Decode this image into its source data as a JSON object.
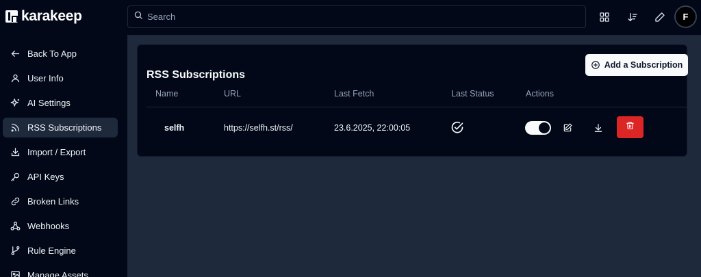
{
  "app": {
    "name": "karakeep"
  },
  "search": {
    "placeholder": "Search"
  },
  "user": {
    "initial": "F"
  },
  "sidebar": {
    "items": [
      {
        "label": "Back To App",
        "icon": "arrow-left-icon"
      },
      {
        "label": "User Info",
        "icon": "user-icon"
      },
      {
        "label": "AI Settings",
        "icon": "sparkles-icon"
      },
      {
        "label": "RSS Subscriptions",
        "icon": "rss-icon",
        "active": true
      },
      {
        "label": "Import / Export",
        "icon": "download-icon"
      },
      {
        "label": "API Keys",
        "icon": "key-icon"
      },
      {
        "label": "Broken Links",
        "icon": "link-icon"
      },
      {
        "label": "Webhooks",
        "icon": "webhook-icon"
      },
      {
        "label": "Rule Engine",
        "icon": "git-branch-icon"
      },
      {
        "label": "Manage Assets",
        "icon": "image-icon"
      }
    ]
  },
  "page": {
    "title": "RSS Subscriptions",
    "add_button": "Add a Subscription",
    "columns": [
      "Name",
      "URL",
      "Last Fetch",
      "Last Status",
      "Actions"
    ],
    "rows": [
      {
        "name": "selfh",
        "url": "https://selfh.st/rss/",
        "last_fetch": "23.6.2025, 22:00:05",
        "last_status": "success",
        "enabled": true
      }
    ]
  },
  "colors": {
    "background": "#020817",
    "panel": "#1e293b",
    "danger": "#dc2626",
    "muted_text": "#94a3b8"
  }
}
